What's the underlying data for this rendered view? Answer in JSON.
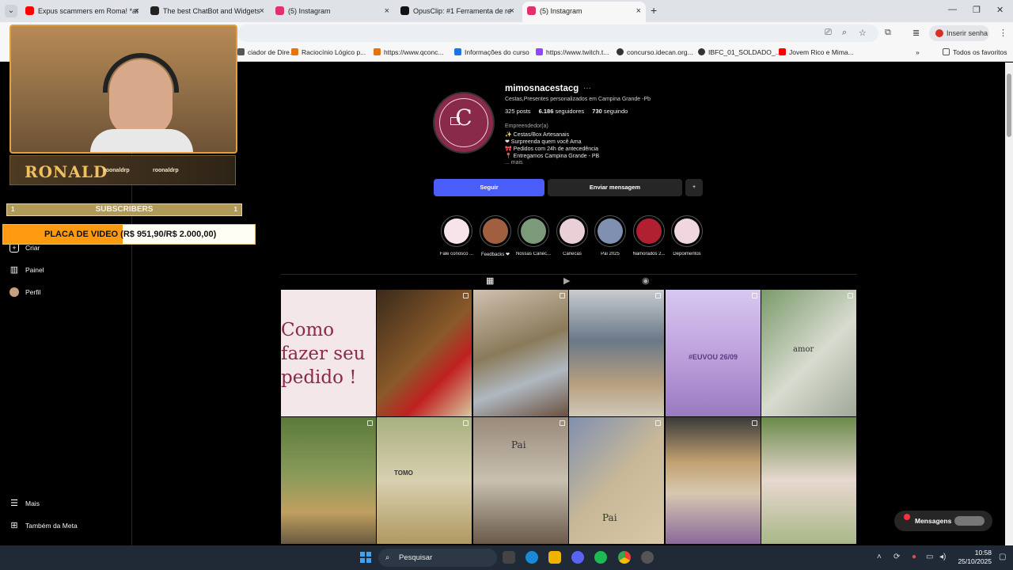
{
  "browser": {
    "tabs": [
      {
        "title": "Expus scammers em Roma! *at",
        "icon_color": "#ff0000"
      },
      {
        "title": "The best ChatBot and Widgets",
        "icon_color": "#222222"
      },
      {
        "title": "(5) Instagram",
        "icon_color": "#e1306c"
      },
      {
        "title": "OpusClip: #1 Ferramenta de re",
        "icon_color": "#111111"
      },
      {
        "title": "(5) Instagram",
        "icon_color": "#e1306c"
      }
    ],
    "signin_label": "Inserir senha",
    "bookmarks": [
      {
        "label": "ciador de Dire...",
        "color": "#555555"
      },
      {
        "label": "Raciocínio Lógico p...",
        "color": "#e8710a"
      },
      {
        "label": "https://www.qconc...",
        "color": "#e8710a"
      },
      {
        "label": "Informações do curso",
        "color": "#1a73e8"
      },
      {
        "label": "https://www.twitch.t...",
        "color": "#9146ff"
      },
      {
        "label": "concurso.idecan.org...",
        "color": "#333333"
      },
      {
        "label": "IBFC_01_SOLDADO_...",
        "color": "#333333"
      },
      {
        "label": "Jovem Rico e Mima...",
        "color": "#ff0000"
      }
    ],
    "all_bookmarks_label": "Todos os favoritos"
  },
  "sidebar": {
    "items": [
      {
        "label": "Criar",
        "icon": "plus-icon"
      },
      {
        "label": "Painel",
        "icon": "dashboard-icon"
      },
      {
        "label": "Perfil",
        "icon": "avatar"
      },
      {
        "label": "Mais",
        "icon": "menu-icon"
      },
      {
        "label": "Também da Meta",
        "icon": "meta-icon"
      }
    ]
  },
  "overlay": {
    "streamer_name": "RONALD",
    "handle_1": "roonaldrp",
    "handle_2": "roonaldrp",
    "subscribers_label": "SUBSCRIBERS",
    "subscribers_left": "1",
    "subscribers_right": "1",
    "goal_text": "PLACA DE VIDEO (R$ 951,90/R$ 2.000,00)",
    "goal_fraction": 0.476
  },
  "profile": {
    "username": "mimosnacestacg",
    "dots": "···",
    "tagline": "Cestas,Presentes personalizados em Campina Grande -Pb",
    "posts": "325 posts",
    "followers_count": "6.186",
    "followers_label": " seguidores",
    "following_count": "730",
    "following_label": " seguindo",
    "category": "Empreendedor(a)",
    "bio_lines": [
      "✨ Cestas/Box Artesanais",
      "❤ Surpreenda quem você Ama",
      "🎀 Pedidos com 24h de antecedência",
      "📍 Entregamos Campina Grande - PB"
    ],
    "more": "... mais",
    "follow_label": "Seguir",
    "message_label": "Enviar mensagem",
    "add_label": "+"
  },
  "highlights": [
    {
      "label": "Fale conosco ...",
      "color": "#f7e4ea"
    },
    {
      "label": "Feedbacks ❤",
      "color": "#a06040"
    },
    {
      "label": "Nossas Canec...",
      "color": "#7a9a7a"
    },
    {
      "label": "Canecas",
      "color": "#e8d0d6"
    },
    {
      "label": "Pai 2025",
      "color": "#8090b0"
    },
    {
      "label": "Namorados 2...",
      "color": "#b02030"
    },
    {
      "label": "Depoimentos",
      "color": "#f0d6de"
    }
  ],
  "posts": [
    {
      "color": "#f3e7e9",
      "caption": "Como fazer seu pedido !"
    },
    {
      "color": "#7a4a2a",
      "caption": ""
    },
    {
      "color": "#9a7a5a",
      "caption": ""
    },
    {
      "color": "#a9b0b8",
      "caption": ""
    },
    {
      "color": "#b89ad8",
      "caption": "#EUVOU  26/09"
    },
    {
      "color": "#c8d0c0",
      "caption": "amor"
    },
    {
      "color": "#6a7a4a",
      "caption": ""
    },
    {
      "color": "#c0b890",
      "caption": "TOMO"
    },
    {
      "color": "#8a7a6a",
      "caption": "Pai"
    },
    {
      "color": "#b8c0d0",
      "caption": "Pai"
    },
    {
      "color": "#c0a880",
      "caption": ""
    },
    {
      "color": "#a8b888",
      "caption": ""
    }
  ],
  "messages_label": "Mensagens",
  "messages_badge": "5",
  "taskbar": {
    "search_placeholder": "Pesquisar",
    "time": "10:58",
    "date": "25/10/2025"
  }
}
